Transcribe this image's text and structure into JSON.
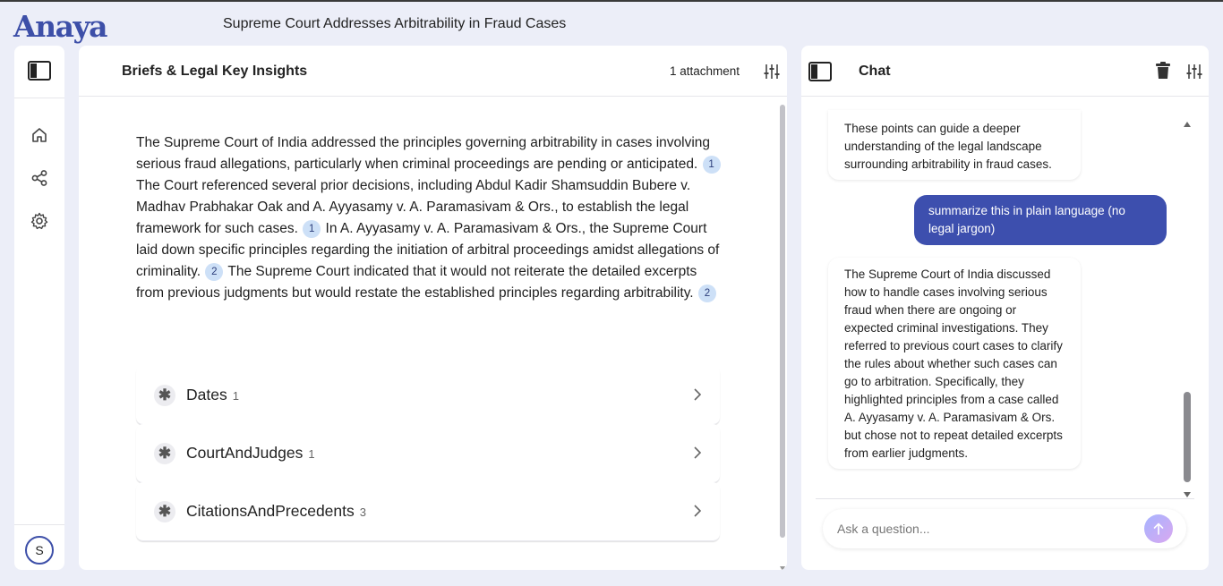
{
  "app": {
    "logo": "Anaya",
    "document_title": "Supreme Court Addresses Arbitrability in Fraud Cases"
  },
  "sidebar": {
    "items": [
      {
        "name": "home",
        "icon": "home-icon"
      },
      {
        "name": "share",
        "icon": "share-icon"
      },
      {
        "name": "settings",
        "icon": "gear-icon"
      }
    ],
    "avatar_initial": "S"
  },
  "main": {
    "title": "Briefs & Legal Key Insights",
    "attachment_label": "1 attachment",
    "summary": [
      {
        "text": "The Supreme Court of India addressed the principles governing arbitrability in cases involving serious fraud allegations, particularly when criminal proceedings are pending or anticipated.",
        "cite": "1"
      },
      {
        "text": "The Court referenced several prior decisions, including Abdul Kadir Shamsuddin Bubere v. Madhav Prabhakar Oak and A. Ayyasamy v. A. Paramasivam & Ors., to establish the legal framework for such cases.",
        "cite": "1"
      },
      {
        "text": "In A. Ayyasamy v. A. Paramasivam & Ors., the Supreme Court laid down specific principles regarding the initiation of arbitral proceedings amidst allegations of criminality.",
        "cite": "2"
      },
      {
        "text": "The Supreme Court indicated that it would not reiterate the detailed excerpts from previous judgments but would restate the established principles regarding arbitrability.",
        "cite": "2"
      }
    ],
    "sections": [
      {
        "label": "Dates",
        "count": "1"
      },
      {
        "label": "CourtAndJudges",
        "count": "1"
      },
      {
        "label": "CitationsAndPrecedents",
        "count": "3"
      }
    ]
  },
  "chat": {
    "title": "Chat",
    "messages": [
      {
        "role": "assistant",
        "text": "These points can guide a deeper understanding of the legal landscape surrounding arbitrability in fraud cases."
      },
      {
        "role": "user",
        "text": "summarize this in plain language (no legal jargon)"
      },
      {
        "role": "assistant",
        "text": "The Supreme Court of India discussed how to handle cases involving serious fraud when there are ongoing or expected criminal investigations. They referred to previous court cases to clarify the rules about whether such cases can go to arbitration. Specifically, they highlighted principles from a case called A. Ayyasamy v. A. Paramasivam & Ors. but chose not to repeat detailed excerpts from earlier judgments."
      }
    ],
    "input": {
      "value": "",
      "placeholder": "Ask a question..."
    }
  },
  "colors": {
    "brand": "#3d4fa8",
    "user_bubble": "#3d4fae",
    "citation_bg": "#cde0f7",
    "background": "#eceef8"
  }
}
